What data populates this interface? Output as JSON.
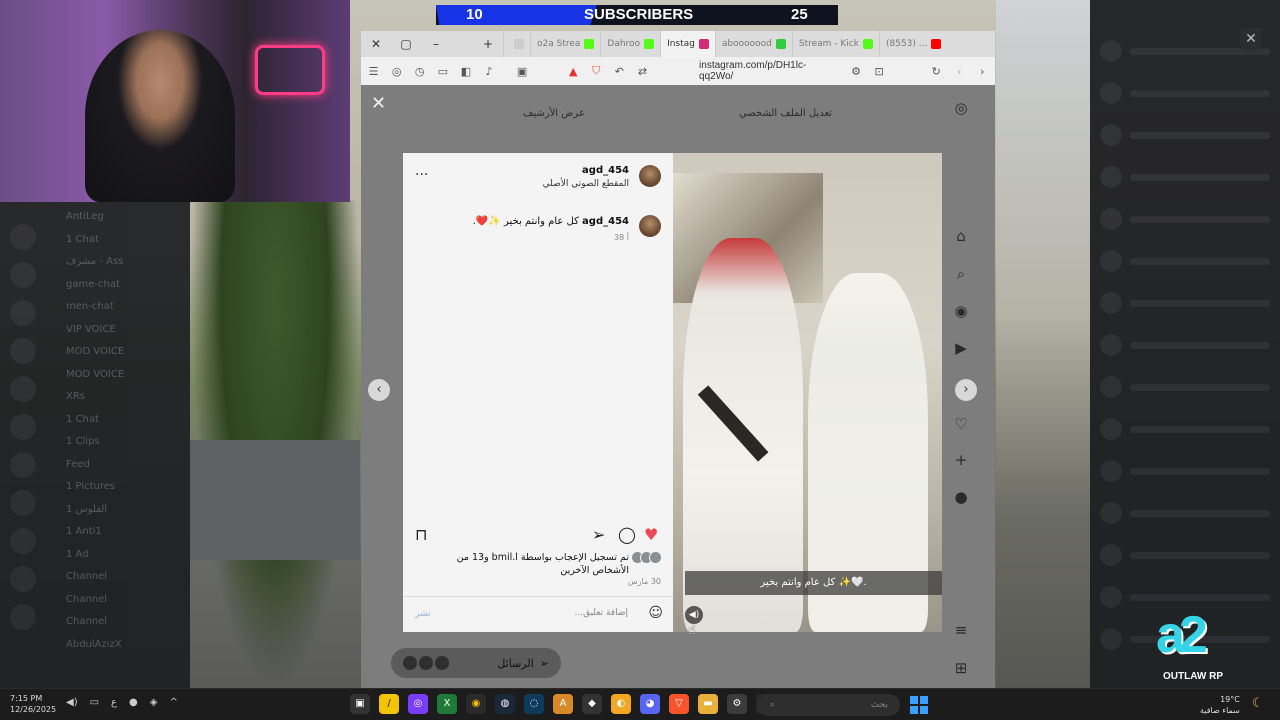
{
  "stream_overlay": {
    "subscriber_bar": {
      "label": "SUBSCRIBERS",
      "current": "10",
      "goal": "25",
      "progress": 0.4
    },
    "logo": {
      "name": "OUTLAW RP"
    }
  },
  "browser": {
    "tabs": [
      {
        "label": "",
        "favicon_color": "#cccccc"
      },
      {
        "label": "o2a Strea",
        "favicon_color": "#53fc18"
      },
      {
        "label": "Dahroo",
        "favicon_color": "#53fc18"
      },
      {
        "label": "Instag",
        "favicon_color": "#d62976",
        "active": true
      },
      {
        "label": "abooooood",
        "favicon_color": "#2ecc40"
      },
      {
        "label": "Stream - Kick",
        "favicon_color": "#53fc18"
      },
      {
        "label": "(8553) ...",
        "favicon_color": "#ff0000"
      }
    ],
    "url": "instagram.com/p/DH1lc-qq2Wo/",
    "accent": "#ff4757"
  },
  "instagram": {
    "header_left": "عرض الأرشيف",
    "header_right": "تعديل الملف الشخصي",
    "post": {
      "username": "agd_454",
      "audio": "المقطع الصوتي الأصلي",
      "comment_user": "agd_454",
      "comment_text": "كل عام وانتم بخير ✨❤️.",
      "comment_time": "38 أ",
      "likes_text": "تم تسجيل الإعجاب بواسطة bmil.l و13 من الأشخاص الآخرين",
      "date": "30 مارس",
      "comment_placeholder": "إضافة تعليق...",
      "post_button": "نشر",
      "caption": "كل عام وانتم بخير ✨🤍."
    },
    "messages_label": "الرسائل",
    "colors": {
      "like": "#ed4956"
    }
  },
  "taskbar": {
    "time": "7:15 PM",
    "date": "12/26/2025",
    "lang": "ع",
    "search_placeholder": "بحث",
    "weather_temp": "19°C",
    "weather_desc": "سماء صافية"
  },
  "left_panel": {
    "channels": [
      "AntiLeg",
      "1 Chat",
      "مشرف - Ass",
      "game-chat",
      "men-chat",
      "VIP VOICE",
      "MOD VOICE",
      "MOD VOICE",
      "XRs",
      "1 Chat",
      "1 Clips",
      "Feed",
      "1 Pictures",
      "1 الفلوس",
      "1 Anti1",
      "1 Ad",
      "Channel",
      "Channel",
      "Channel",
      "AbdulAzizX"
    ]
  }
}
